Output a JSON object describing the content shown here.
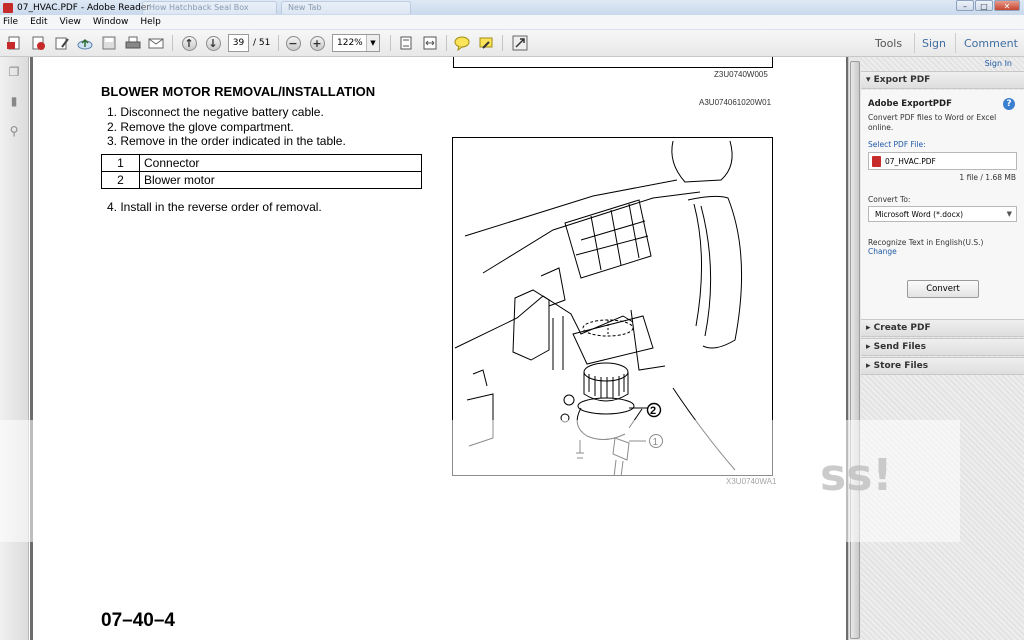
{
  "window": {
    "title": "07_HVAC.PDF - Adobe Reader",
    "ghost_tabs": [
      "How Hatchback Seal Box",
      "New Tab"
    ]
  },
  "menu": [
    "File",
    "Edit",
    "View",
    "Window",
    "Help"
  ],
  "toolbar": {
    "page_number": "39",
    "page_total": "/ 51",
    "zoom": "122%",
    "tools": "Tools",
    "sign": "Sign",
    "comment": "Comment"
  },
  "document": {
    "top_code": "Z3U0740W005",
    "ref_code": "A3U074061020W01",
    "heading": "BLOWER MOTOR REMOVAL/INSTALLATION",
    "steps": [
      "1.  Disconnect the negative battery cable.",
      "2.  Remove the glove compartment.",
      "3.  Remove in the order indicated in the table."
    ],
    "table": [
      {
        "num": "1",
        "part": "Connector"
      },
      {
        "num": "2",
        "part": "Blower motor"
      }
    ],
    "step4": "4.  Install in the reverse order of removal.",
    "figure_code": "X3U0740WA1",
    "callout_1": "1",
    "callout_2": "2",
    "page_footer": "07–40–4"
  },
  "panel": {
    "sign_in": "Sign In",
    "export_pdf": "Export PDF",
    "adobe_exportpdf": "Adobe ExportPDF",
    "description": "Convert PDF files to Word or Excel online.",
    "select_label": "Select PDF File:",
    "file_name": "07_HVAC.PDF",
    "file_info": "1 file / 1.68 MB",
    "convert_to_label": "Convert To:",
    "convert_to_value": "Microsoft Word (*.docx)",
    "recognize_text": "Recognize Text in English(U.S.)",
    "change": "Change",
    "convert_button": "Convert",
    "create_pdf": "Create PDF",
    "send_files": "Send Files",
    "store_files": "Store Files"
  },
  "watermark": "ss!",
  "colors": {
    "accent_blue": "#1f5aa6",
    "pdf_red": "#c62a2a"
  }
}
